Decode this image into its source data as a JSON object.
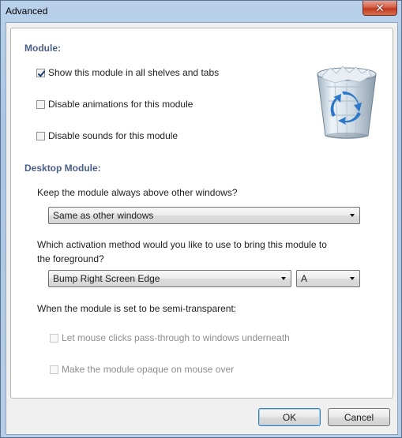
{
  "window": {
    "title": "Advanced",
    "close_symbol": "✕"
  },
  "module": {
    "heading": "Module:",
    "options": [
      {
        "label": "Show this module in all shelves and tabs",
        "checked": true
      },
      {
        "label": "Disable animations for this module",
        "checked": false
      },
      {
        "label": "Disable sounds for this module",
        "checked": false
      }
    ],
    "image": "recycle-bin-icon"
  },
  "desktop": {
    "heading": "Desktop Module:",
    "above_question": "Keep the module always above other windows?",
    "above_value": "Same as other windows",
    "activation_question_line1": "Which activation method would you like to use to bring this module to",
    "activation_question_line2": "the foreground?",
    "activation_value": "Bump Right Screen Edge",
    "key_value": "A",
    "semi_label": "When the module is set to be semi-transparent:",
    "semi_options": [
      {
        "label": "Let mouse clicks pass-through to windows underneath",
        "checked": false,
        "enabled": false
      },
      {
        "label": "Make the module opaque on mouse over",
        "checked": false,
        "enabled": false
      }
    ]
  },
  "buttons": {
    "ok": "OK",
    "cancel": "Cancel"
  }
}
